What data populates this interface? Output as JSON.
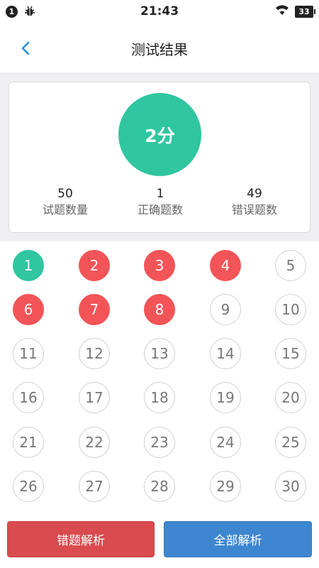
{
  "status_bar": {
    "notification_count": "1",
    "time": "21:43",
    "battery": "33",
    "icons": [
      "notification-badge",
      "bug-icon",
      "wifi-icon",
      "battery-icon"
    ]
  },
  "header": {
    "title": "测试结果",
    "back_icon": "chevron-left-icon"
  },
  "summary": {
    "score": "2分",
    "stats": [
      {
        "value": "50",
        "label": "试题数量"
      },
      {
        "value": "1",
        "label": "正确题数"
      },
      {
        "value": "49",
        "label": "错误题数"
      }
    ]
  },
  "questions": [
    {
      "n": "1",
      "status": "correct"
    },
    {
      "n": "2",
      "status": "wrong"
    },
    {
      "n": "3",
      "status": "wrong"
    },
    {
      "n": "4",
      "status": "wrong"
    },
    {
      "n": "5",
      "status": "unanswered"
    },
    {
      "n": "6",
      "status": "wrong"
    },
    {
      "n": "7",
      "status": "wrong"
    },
    {
      "n": "8",
      "status": "wrong"
    },
    {
      "n": "9",
      "status": "unanswered"
    },
    {
      "n": "10",
      "status": "unanswered"
    },
    {
      "n": "11",
      "status": "unanswered"
    },
    {
      "n": "12",
      "status": "unanswered"
    },
    {
      "n": "13",
      "status": "unanswered"
    },
    {
      "n": "14",
      "status": "unanswered"
    },
    {
      "n": "15",
      "status": "unanswered"
    },
    {
      "n": "16",
      "status": "unanswered"
    },
    {
      "n": "17",
      "status": "unanswered"
    },
    {
      "n": "18",
      "status": "unanswered"
    },
    {
      "n": "19",
      "status": "unanswered"
    },
    {
      "n": "20",
      "status": "unanswered"
    },
    {
      "n": "21",
      "status": "unanswered"
    },
    {
      "n": "22",
      "status": "unanswered"
    },
    {
      "n": "23",
      "status": "unanswered"
    },
    {
      "n": "24",
      "status": "unanswered"
    },
    {
      "n": "25",
      "status": "unanswered"
    },
    {
      "n": "26",
      "status": "unanswered"
    },
    {
      "n": "27",
      "status": "unanswered"
    },
    {
      "n": "28",
      "status": "unanswered"
    },
    {
      "n": "29",
      "status": "unanswered"
    },
    {
      "n": "30",
      "status": "unanswered"
    }
  ],
  "buttons": {
    "wrong_analysis": "错题解析",
    "all_analysis": "全部解析"
  },
  "colors": {
    "correct": "#2fc6a0",
    "wrong": "#f35457",
    "wrong_button": "#d94b4e",
    "all_button": "#3e87d0",
    "accent_back": "#2a8fd6"
  }
}
